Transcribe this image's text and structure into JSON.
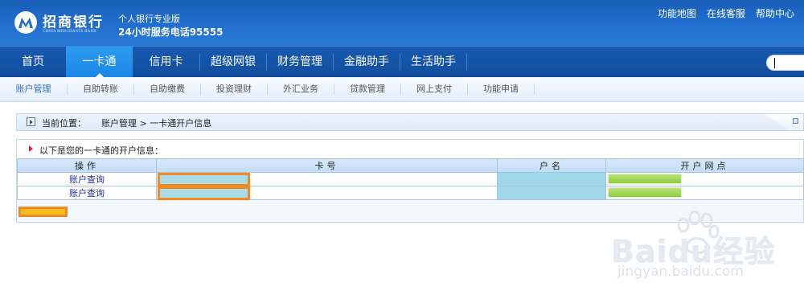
{
  "header": {
    "logo_name": "招商银行",
    "logo_en": "CHINA MERCHANTS BANK",
    "slogan_line1": "个人银行专业版",
    "slogan_line2": "24小时服务电话95555",
    "top_links": [
      "功能地图",
      "在线客服",
      "帮助中心"
    ]
  },
  "main_nav": {
    "items": [
      "首页",
      "一卡通",
      "信用卡",
      "超级网银",
      "财务管理",
      "金融助手",
      "生活助手"
    ],
    "active_index": 1
  },
  "sub_nav": {
    "items": [
      "账户管理",
      "自助转账",
      "自助缴费",
      "投资理财",
      "外汇业务",
      "贷款管理",
      "网上支付",
      "功能申请"
    ],
    "active_index": 0
  },
  "breadcrumb": {
    "label": "当前位置：",
    "path": "账户管理 > 一卡通开户信息"
  },
  "info_panel": {
    "title": "以下是您的一卡通的开户信息：",
    "columns": [
      "操作",
      "卡号",
      "户名",
      "开户网点"
    ],
    "rows": [
      {
        "action": "账户查询"
      },
      {
        "action": "账户查询"
      }
    ]
  },
  "watermark": {
    "brand": "Bai",
    "brand_mid": "du",
    "brand_cn": "经验",
    "url": "jingyan.baidu.com"
  },
  "colors": {
    "header_blue": "#1f6ccc",
    "nav_dark": "#124e9e",
    "nav_active": "#1b86e6",
    "link_blue": "#1b2fa8",
    "redaction_orange": "#f08a24",
    "redaction_green": "#8fce3f",
    "redaction_cyan": "#a0d8ea"
  }
}
